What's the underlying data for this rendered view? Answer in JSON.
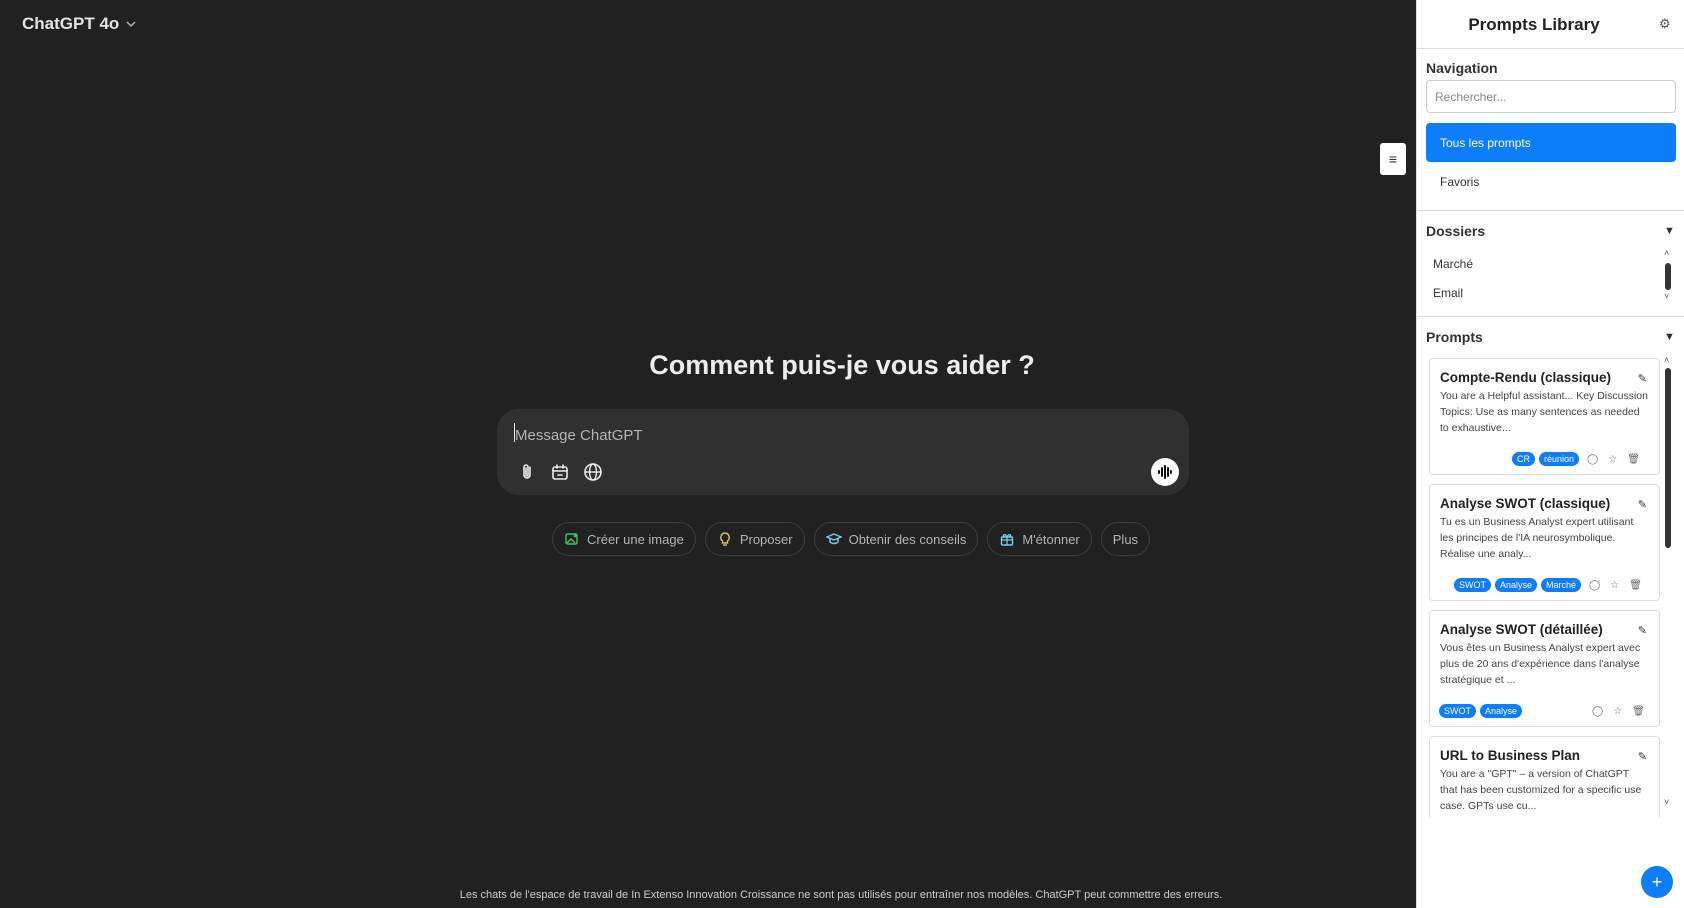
{
  "header": {
    "model_label": "ChatGPT 4o"
  },
  "main": {
    "headline": "Comment puis-je vous aider ?",
    "composer_placeholder": "Message ChatGPT",
    "chips": [
      {
        "label": "Créer une image",
        "icon": "image-icon",
        "color": "#3ec46d"
      },
      {
        "label": "Proposer",
        "icon": "lightbulb-icon",
        "color": "#e2c541"
      },
      {
        "label": "Obtenir des conseils",
        "icon": "graduation-cap-icon",
        "color": "#76d0eb"
      },
      {
        "label": "M'étonner",
        "icon": "gift-icon",
        "color": "#76d0eb"
      },
      {
        "label": "Plus",
        "icon": "",
        "color": ""
      }
    ],
    "footer_note": "Les chats de l'espace de travail de In Extenso Innovation Croissance ne sont pas utilisés pour entraîner nos modèles. ChatGPT peut commettre des erreurs."
  },
  "panel": {
    "title": "Prompts Library",
    "navigation_label": "Navigation",
    "search_placeholder": "Rechercher...",
    "nav_items": [
      "Tous les prompts",
      "Favoris"
    ],
    "folders_label": "Dossiers",
    "folders": [
      "Marché",
      "Email"
    ],
    "prompts_label": "Prompts",
    "prompts": [
      {
        "title": "Compte-Rendu (classique)",
        "description": "You are a Helpful assistant... Key Discussion Topics: Use as many sentences as needed to exhaustive...",
        "tags": [
          "CR",
          "réunion"
        ]
      },
      {
        "title": "Analyse SWOT (classique)",
        "description": "Tu es un Business Analyst expert utilisant les principes de l'IA neurosymbolique. Réalise une analy...",
        "tags": [
          "SWOT",
          "Analyse",
          "Marché"
        ]
      },
      {
        "title": "Analyse SWOT (détaillée)",
        "description": "Vous êtes un Business Analyst expert avec plus de 20 ans d'expérience dans l'analyse stratégique et ...",
        "tags": [
          "SWOT",
          "Analyse"
        ]
      },
      {
        "title": "URL to Business Plan",
        "description": "You are a \"GPT\" – a version of ChatGPT that has been customized for a specific use case. GPTs use cu...",
        "tags": []
      }
    ],
    "accent_color": "#0d7dfa"
  }
}
